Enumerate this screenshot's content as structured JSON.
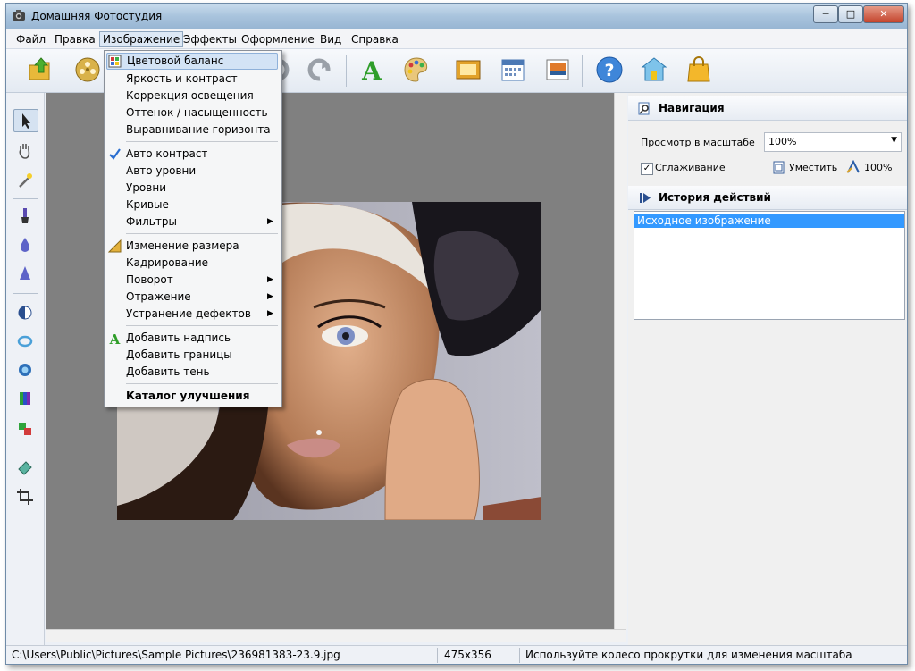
{
  "window": {
    "title": "Домашняя Фотостудия",
    "controls": {
      "minimize": "─",
      "maximize": "□",
      "close": "✕"
    }
  },
  "menubar": [
    "Файл",
    "Правка",
    "Изображение",
    "Эффекты",
    "Оформление",
    "Вид",
    "Справка"
  ],
  "active_menu": "Изображение",
  "image_menu": [
    {
      "label": "Цветовой баланс",
      "icon": "color-balance-icon",
      "highlighted": true
    },
    {
      "label": "Яркость и контраст"
    },
    {
      "label": "Коррекция освещения"
    },
    {
      "label": "Оттенок / насыщенность"
    },
    {
      "label": "Выравнивание горизонта"
    },
    {
      "label": "Авто контраст",
      "icon": "checkmark-icon",
      "checked": true
    },
    {
      "label": "Авто уровни"
    },
    {
      "label": "Уровни"
    },
    {
      "label": "Кривые"
    },
    {
      "label": "Фильтры",
      "submenu": true
    },
    {
      "label": "Изменение размера",
      "icon": "resize-icon"
    },
    {
      "label": "Кадрирование"
    },
    {
      "label": "Поворот",
      "submenu": true
    },
    {
      "label": "Отражение",
      "submenu": true
    },
    {
      "label": "Устранение дефектов",
      "submenu": true
    },
    {
      "label": "Добавить надпись",
      "icon": "text-a-icon"
    },
    {
      "label": "Добавить границы"
    },
    {
      "label": "Добавить тень"
    },
    {
      "label": "Каталог улучшения",
      "bold": true
    }
  ],
  "toolbar_icons": [
    "open-folder-icon",
    "film-reel-icon",
    "undo-icon",
    "redo-icon",
    "text-a-icon",
    "palette-icon",
    "frame-icon",
    "calendar-icon",
    "postcard-icon",
    "help-icon",
    "home-icon",
    "shopping-bag-icon"
  ],
  "left_tools": [
    "pointer-icon",
    "hand-icon",
    "magic-wand-icon",
    "brush-icon",
    "drop-icon",
    "cone-icon",
    "contrast-icon",
    "ring-icon",
    "target-icon",
    "color-bars-icon",
    "colors-swap-icon",
    "eraser-icon",
    "crop-icon"
  ],
  "navigation": {
    "title": "Навигация",
    "zoom_label": "Просмотр в масштабе",
    "zoom_value": "100%",
    "smoothing_label": "Сглаживание",
    "smoothing_checked": true,
    "fit_label": "Уместить",
    "actual_label": "100%"
  },
  "history": {
    "title": "История действий",
    "items": [
      "Исходное изображение"
    ]
  },
  "status": {
    "path": "C:\\Users\\Public\\Pictures\\Sample Pictures\\236981383-23.9.jpg",
    "dimensions": "475x356",
    "hint": "Используйте колесо прокрутки для изменения масштаба"
  },
  "colors": {
    "accent": "#3399ff",
    "canvas": "#808080",
    "highlight": "#d3e3f5"
  }
}
